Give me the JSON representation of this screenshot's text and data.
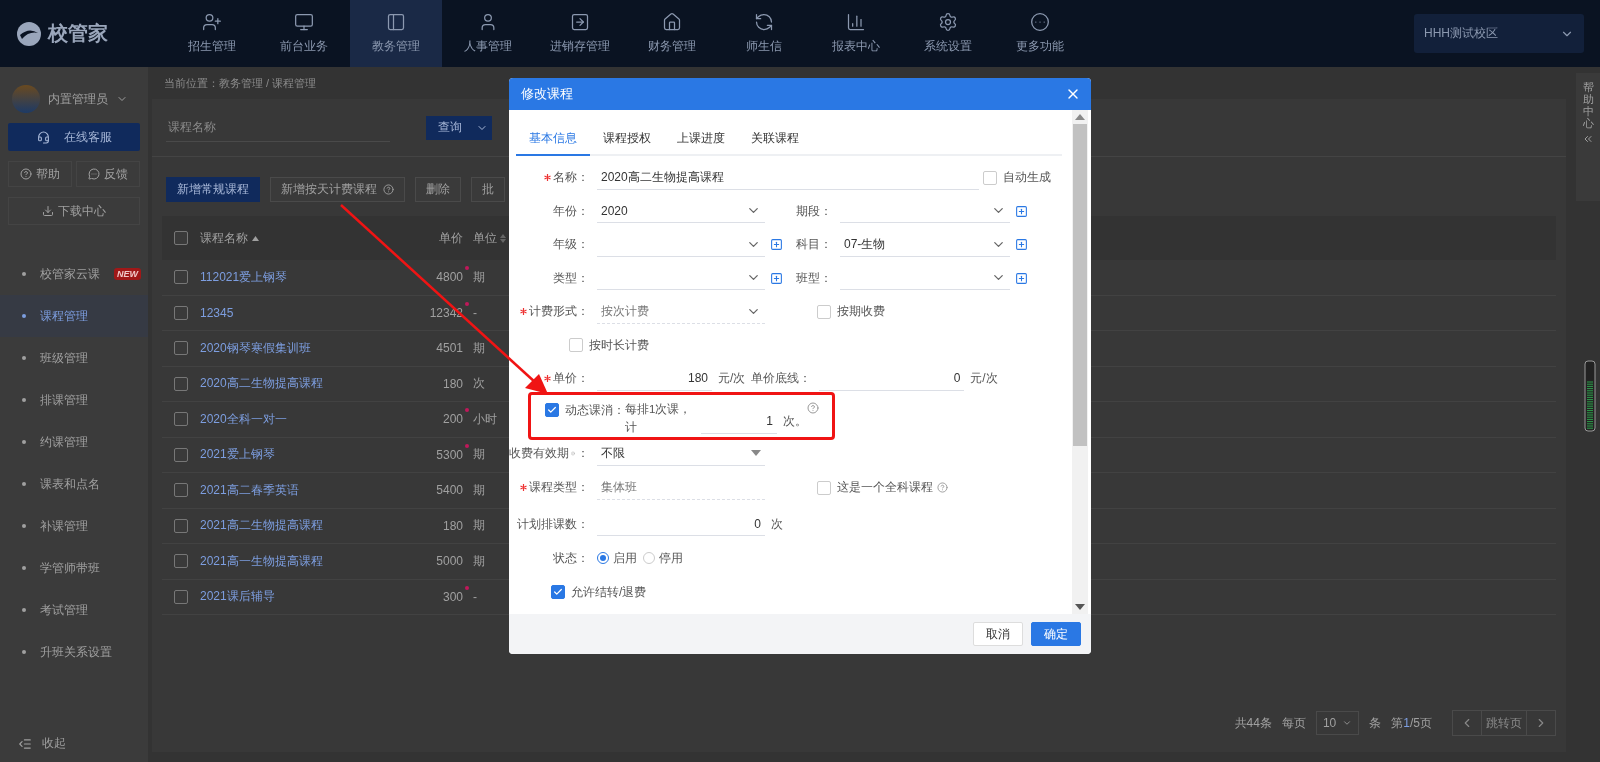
{
  "topbar": {
    "logo": "校管家",
    "nav": [
      {
        "label": "招生管理",
        "selected": false
      },
      {
        "label": "前台业务",
        "selected": false
      },
      {
        "label": "教务管理",
        "selected": true
      },
      {
        "label": "人事管理",
        "selected": false
      },
      {
        "label": "进销存管理",
        "selected": false
      },
      {
        "label": "财务管理",
        "selected": false
      },
      {
        "label": "师生信",
        "selected": false
      },
      {
        "label": "报表中心",
        "selected": false
      },
      {
        "label": "系统设置",
        "selected": false
      },
      {
        "label": "更多功能",
        "selected": false
      }
    ],
    "campus": "HHH测试校区"
  },
  "sidebar": {
    "user": "内置管理员",
    "service_button": "在线客服",
    "help": "帮助",
    "feedback": "反馈",
    "download": "下载中心",
    "items": [
      {
        "label": "校管家云课",
        "badge": "NEW",
        "selected": false
      },
      {
        "label": "课程管理",
        "selected": true
      },
      {
        "label": "班级管理",
        "selected": false
      },
      {
        "label": "排课管理",
        "selected": false
      },
      {
        "label": "约课管理",
        "selected": false
      },
      {
        "label": "课表和点名",
        "selected": false
      },
      {
        "label": "补课管理",
        "selected": false
      },
      {
        "label": "学管师带班",
        "selected": false
      },
      {
        "label": "考试管理",
        "selected": false
      },
      {
        "label": "升班关系设置",
        "selected": false
      }
    ],
    "collapse": "收起"
  },
  "breadcrumb": "当前位置：教务管理 / 课程管理",
  "search": {
    "placeholder": "课程名称",
    "button": "查询"
  },
  "actions": [
    {
      "label": "新增常规课程",
      "primary": true,
      "help": false
    },
    {
      "label": "新增按天计费课程",
      "primary": false,
      "help": true
    },
    {
      "label": "删除",
      "primary": false,
      "help": false
    },
    {
      "label": "批",
      "primary": false,
      "help": false
    }
  ],
  "table": {
    "columns": [
      "课程名称",
      "单价",
      "单位"
    ],
    "header_checked": false,
    "rows": [
      {
        "name": "112021爱上钢琴",
        "price": "4800",
        "unit": "期",
        "marked": true,
        "checked": false
      },
      {
        "name": "12345",
        "price": "12342",
        "unit": "-",
        "marked": true,
        "checked": false
      },
      {
        "name": "2020钢琴寒假集训班",
        "price": "4501",
        "unit": "期",
        "marked": false,
        "checked": false
      },
      {
        "name": "2020高二生物提高课程",
        "price": "180",
        "unit": "次",
        "marked": false,
        "checked": false
      },
      {
        "name": "2020全科一对一",
        "price": "200",
        "unit": "小时",
        "marked": true,
        "checked": false
      },
      {
        "name": "2021爱上钢琴",
        "price": "5300",
        "unit": "期",
        "marked": true,
        "checked": false
      },
      {
        "name": "2021高二春季英语",
        "price": "5400",
        "unit": "期",
        "marked": false,
        "checked": false
      },
      {
        "name": "2021高二生物提高课程",
        "price": "180",
        "unit": "期",
        "marked": false,
        "checked": false
      },
      {
        "name": "2021高一生物提高课程",
        "price": "5000",
        "unit": "期",
        "marked": false,
        "checked": false
      },
      {
        "name": "2021课后辅导",
        "price": "300",
        "unit": "-",
        "marked": true,
        "checked": false
      }
    ]
  },
  "pagination": {
    "total": "共44条",
    "per_page_label": "每页",
    "per_page": "10",
    "unit": "条",
    "page_prefix": "第",
    "page_current": "1",
    "page_rest": "/5页",
    "jump_placeholder": "跳转页"
  },
  "help_tab": "帮助中心",
  "modal": {
    "title": "修改课程",
    "tabs": [
      {
        "label": "基本信息",
        "selected": true
      },
      {
        "label": "课程授权",
        "selected": false
      },
      {
        "label": "上课进度",
        "selected": false
      },
      {
        "label": "关联课程",
        "selected": false
      }
    ],
    "name": {
      "label": "名称：",
      "required": true,
      "value": "2020高二生物提高课程"
    },
    "auto_generate": {
      "label": "自动生成",
      "checked": false
    },
    "selects": [
      [
        {
          "label": "年份：",
          "value": "2020",
          "add": false
        },
        {
          "label": "期段：",
          "add": true
        }
      ],
      [
        {
          "label": "年级：",
          "add": true
        },
        {
          "label": "科目：",
          "value": "07-生物",
          "add": true
        }
      ],
      [
        {
          "label": "类型：",
          "add": true
        },
        {
          "label": "班型：",
          "add": true
        }
      ]
    ],
    "billing": {
      "label": "计费形式：",
      "required": true,
      "value": "按次计费",
      "disabled": true
    },
    "per_term": {
      "label": "按期收费",
      "checked": false
    },
    "by_duration": {
      "label": "按时长计费",
      "checked": false
    },
    "price": {
      "label": "单价：",
      "required": true,
      "value": "180",
      "unit": "元/次"
    },
    "price_floor": {
      "label": "单价底线：",
      "value": "0",
      "unit": "元/次"
    },
    "dynamic": {
      "label": "动态课消：",
      "checked": true,
      "text": "每排1次课，计",
      "value": "1",
      "unit": "次。"
    },
    "validity": {
      "label": "收费有效期",
      "suffix": "：",
      "value": "不限"
    },
    "course_type": {
      "label": "课程类型：",
      "required": true,
      "value": "集体班",
      "disabled": true
    },
    "all_subject": {
      "label": "这是一个全科课程",
      "checked": false
    },
    "planned": {
      "label": "计划排课数：",
      "value": "0",
      "unit": "次"
    },
    "status": {
      "label": "状态：",
      "options": [
        {
          "label": "启用",
          "selected": true
        },
        {
          "label": "停用",
          "selected": false
        }
      ]
    },
    "transfer": {
      "label": "允许结转/退费",
      "checked": true
    },
    "buttons": [
      {
        "label": "取消",
        "primary": false
      },
      {
        "label": "确定",
        "primary": true
      }
    ]
  }
}
